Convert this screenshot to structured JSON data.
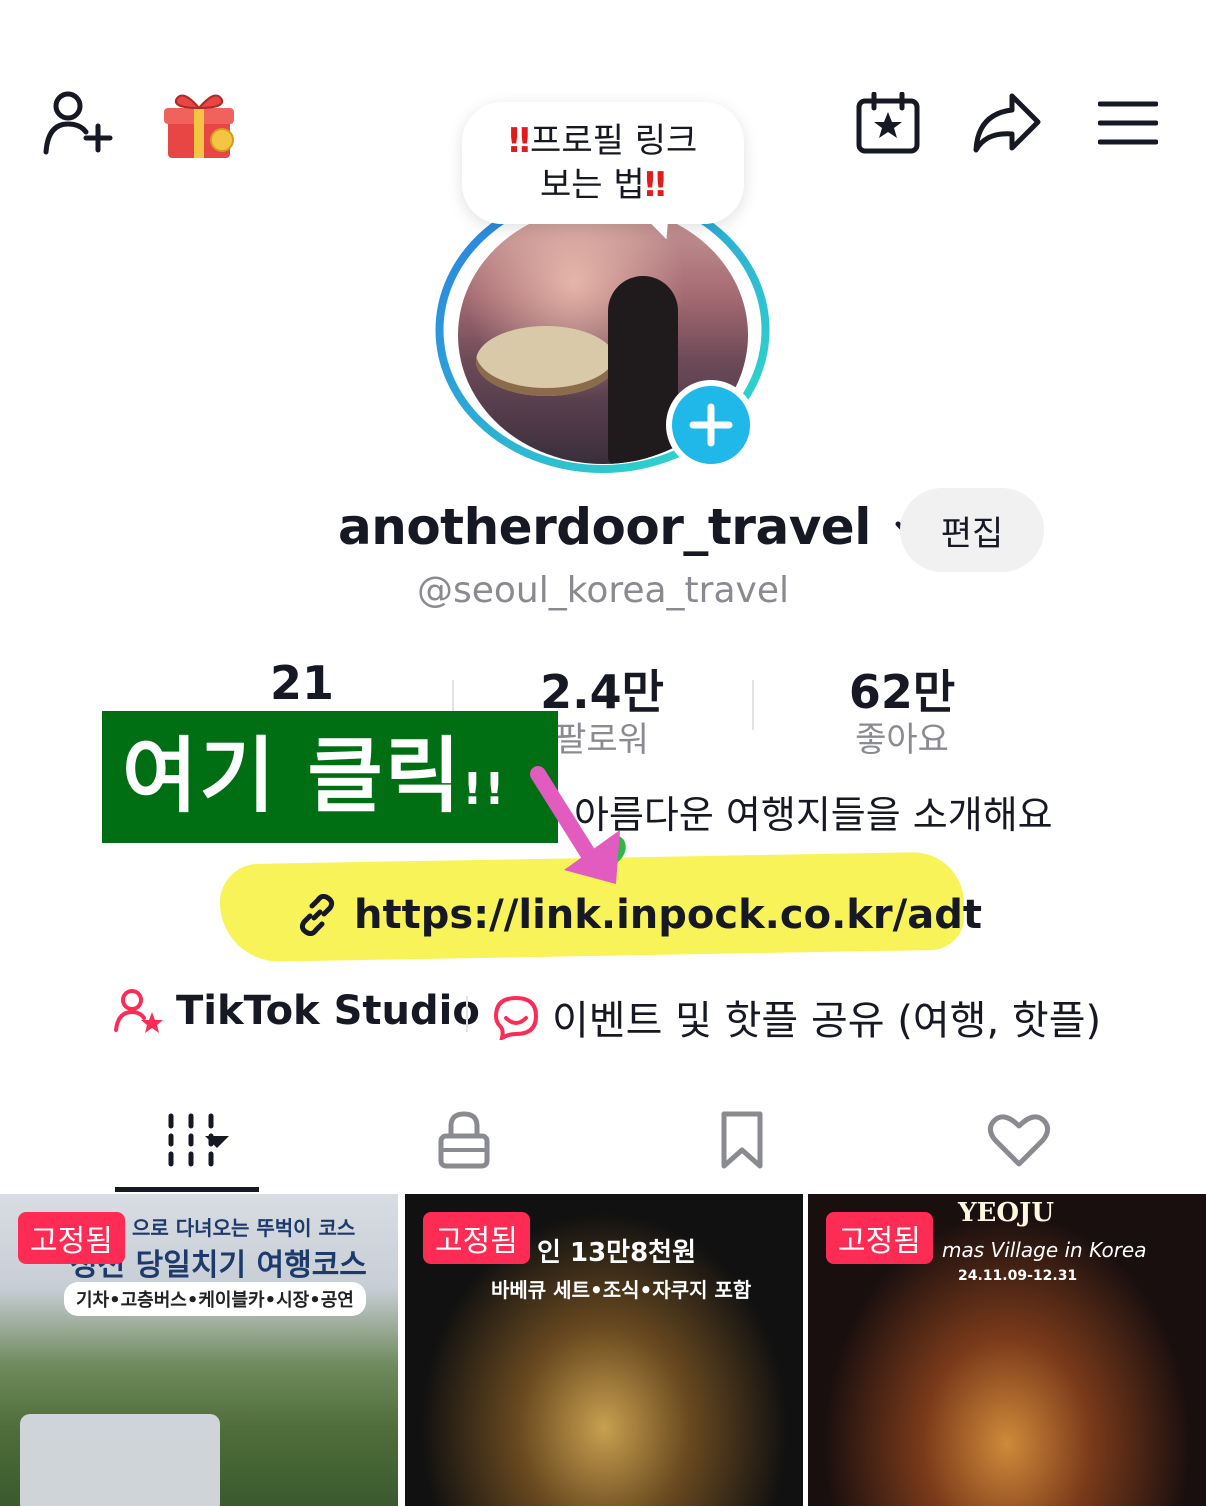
{
  "bubble": {
    "line1": "프로필 링크",
    "line2": "보는 법",
    "marks": "‼"
  },
  "profile": {
    "username": "anotherdoor_travel",
    "handle": "@seoul_korea_travel",
    "edit_label": "편집"
  },
  "stats": [
    {
      "value": "21",
      "label": ""
    },
    {
      "value": "2.4만",
      "label": "팔로워"
    },
    {
      "value": "62만",
      "label": "좋아요"
    }
  ],
  "banner": {
    "text": "여기 클릭",
    "exclaim": "!!"
  },
  "bio": "아름다운 여행지들을 소개해요",
  "link": "https://link.inpock.co.kr/adt",
  "shortcuts": {
    "studio": "TikTok Studio",
    "event": "이벤트 및 핫플 공유 (여행, 핫플)"
  },
  "tabs": [
    "videos-grid-icon",
    "lock-icon",
    "bookmark-icon",
    "heart-icon"
  ],
  "videos": [
    {
      "pinned": "고정됨",
      "caption1": "으로 다녀오는 뚜벅이 코스",
      "caption2": "정선 당일치기 여행코스",
      "caption3": "기차•고층버스•케이블카•시장•공연"
    },
    {
      "pinned": "고정됨",
      "caption1": "인 13만8천원",
      "caption2": "바베큐 세트•조식•자쿠지 포함"
    },
    {
      "pinned": "고정됨",
      "caption1": "YEOJU",
      "caption2": "mas Village in Korea",
      "caption3": "24.11.09-12.31"
    }
  ],
  "colors": {
    "accent_red": "#fe2c55",
    "banner_green": "#006f14",
    "highlight_yellow": "#f6f24a",
    "ring_start": "#2a7de1",
    "ring_end": "#2fe0c8"
  }
}
